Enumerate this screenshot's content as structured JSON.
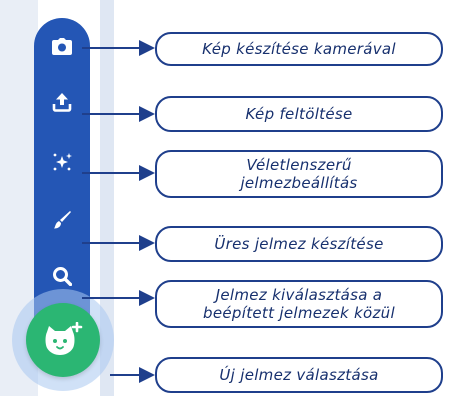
{
  "toolbar": {
    "items": [
      {
        "icon": "camera-icon",
        "label": "Kép készítése kamerával"
      },
      {
        "icon": "upload-icon",
        "label": "Kép feltöltése"
      },
      {
        "icon": "sparkle-icon",
        "label": "Véletlenszerű\njelmezbeállítás"
      },
      {
        "icon": "paintbrush-icon",
        "label": "Üres jelmez készítése"
      },
      {
        "icon": "search-icon",
        "label": "Jelmez kiválasztása a\nbeépített jelmezek közül"
      }
    ],
    "fab": {
      "icon": "cat-plus-icon",
      "label": "Új jelmez választása"
    }
  },
  "colors": {
    "toolbar": "#2456b5",
    "fab": "#2bb673",
    "callout_border": "#1f3f8c",
    "callout_text": "#17306e"
  }
}
